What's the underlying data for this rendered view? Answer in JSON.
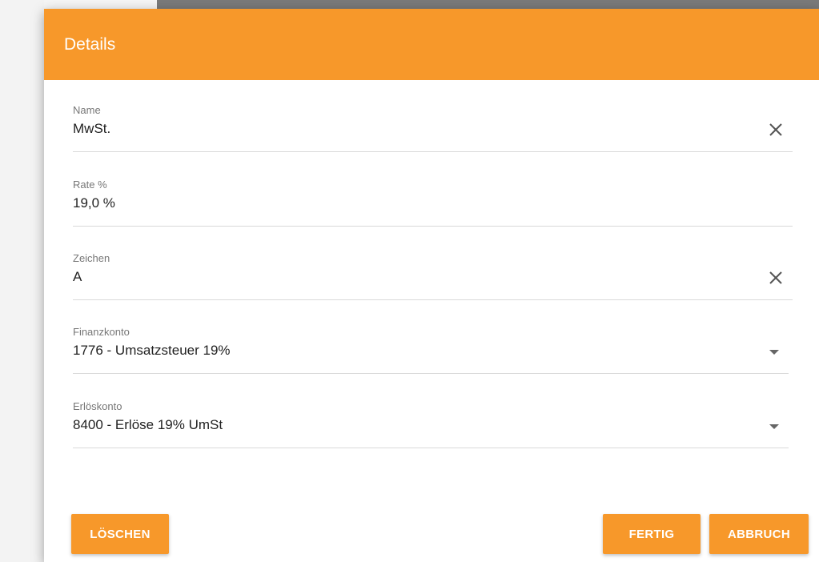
{
  "dialog": {
    "title": "Details"
  },
  "fields": {
    "name": {
      "label": "Name",
      "value": "MwSt."
    },
    "rate": {
      "label": "Rate %",
      "value": "19,0 %"
    },
    "zeichen": {
      "label": "Zeichen",
      "value": "A"
    },
    "finanzkonto": {
      "label": "Finanzkonto",
      "value": "1776 - Umsatzsteuer 19%"
    },
    "erloeskonto": {
      "label": "Erlöskonto",
      "value": "8400 - Erlöse 19% UmSt"
    }
  },
  "buttons": {
    "delete": "LÖSCHEN",
    "done": "FERTIG",
    "cancel": "ABBRUCH"
  },
  "icons": {
    "clear": "close-icon",
    "dropdown": "dropdown-arrow-icon"
  },
  "colors": {
    "accent": "#f7982a"
  }
}
